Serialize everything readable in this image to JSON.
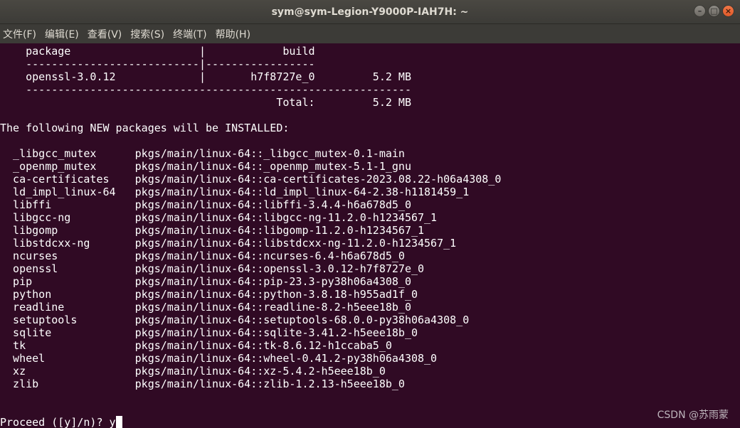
{
  "window": {
    "title": "sym@sym-Legion-Y9000P-IAH7H: ~",
    "buttons": {
      "minimize": "–",
      "maximize": "□",
      "close": "×"
    }
  },
  "menu": [
    "文件(F)",
    "编辑(E)",
    "查看(V)",
    "搜索(S)",
    "终端(T)",
    "帮助(H)"
  ],
  "terminal": {
    "lines": [
      "    package                    |            build",
      "    ---------------------------|-----------------",
      "    openssl-3.0.12             |       h7f8727e_0         5.2 MB",
      "    ------------------------------------------------------------",
      "                                           Total:         5.2 MB",
      "",
      "The following NEW packages will be INSTALLED:",
      "",
      "  _libgcc_mutex      pkgs/main/linux-64::_libgcc_mutex-0.1-main",
      "  _openmp_mutex      pkgs/main/linux-64::_openmp_mutex-5.1-1_gnu",
      "  ca-certificates    pkgs/main/linux-64::ca-certificates-2023.08.22-h06a4308_0",
      "  ld_impl_linux-64   pkgs/main/linux-64::ld_impl_linux-64-2.38-h1181459_1",
      "  libffi             pkgs/main/linux-64::libffi-3.4.4-h6a678d5_0",
      "  libgcc-ng          pkgs/main/linux-64::libgcc-ng-11.2.0-h1234567_1",
      "  libgomp            pkgs/main/linux-64::libgomp-11.2.0-h1234567_1",
      "  libstdcxx-ng       pkgs/main/linux-64::libstdcxx-ng-11.2.0-h1234567_1",
      "  ncurses            pkgs/main/linux-64::ncurses-6.4-h6a678d5_0",
      "  openssl            pkgs/main/linux-64::openssl-3.0.12-h7f8727e_0",
      "  pip                pkgs/main/linux-64::pip-23.3-py38h06a4308_0",
      "  python             pkgs/main/linux-64::python-3.8.18-h955ad1f_0",
      "  readline           pkgs/main/linux-64::readline-8.2-h5eee18b_0",
      "  setuptools         pkgs/main/linux-64::setuptools-68.0.0-py38h06a4308_0",
      "  sqlite             pkgs/main/linux-64::sqlite-3.41.2-h5eee18b_0",
      "  tk                 pkgs/main/linux-64::tk-8.6.12-h1ccaba5_0",
      "  wheel              pkgs/main/linux-64::wheel-0.41.2-py38h06a4308_0",
      "  xz                 pkgs/main/linux-64::xz-5.4.2-h5eee18b_0",
      "  zlib               pkgs/main/linux-64::zlib-1.2.13-h5eee18b_0",
      "",
      ""
    ],
    "prompt": "Proceed ([y]/n)? ",
    "input": "y"
  },
  "watermark": "CSDN @苏雨蒙",
  "colors": {
    "terminal_bg": "#300a24",
    "text": "#ffffff",
    "titlebar": "#3c3b37",
    "close_button": "#e95420"
  }
}
